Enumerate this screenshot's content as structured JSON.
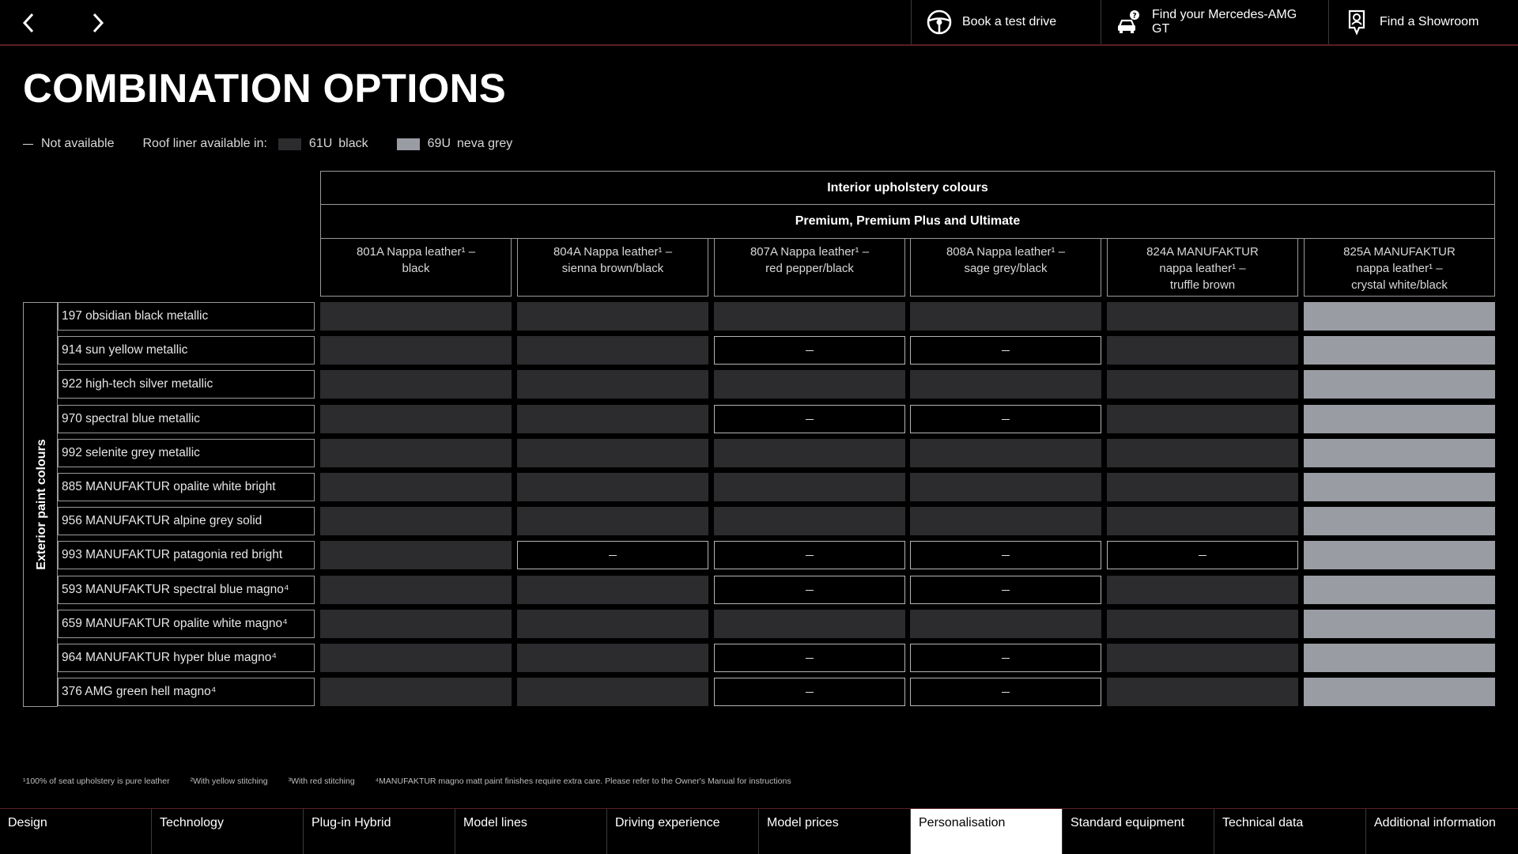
{
  "top_bar": {
    "actions": [
      {
        "label": "Book a test drive",
        "icon": "steering-wheel-icon"
      },
      {
        "label": "Find your Mercedes-AMG GT",
        "icon": "car-question-icon"
      },
      {
        "label": "Find a Showroom",
        "icon": "location-pin-icon"
      }
    ]
  },
  "page": {
    "title": "COMBINATION OPTIONS"
  },
  "legend": {
    "not_available": "Not available",
    "roof_liner_label": "Roof liner available in:",
    "roof_options": [
      {
        "code": "61U",
        "name": "black",
        "color": "#2c2c2e"
      },
      {
        "code": "69U",
        "name": "neva grey",
        "color": "#9a9ca3"
      }
    ]
  },
  "table": {
    "header_1": "Interior upholstery colours",
    "header_2": "Premium, Premium Plus and Ultimate",
    "side_label": "Exterior paint colours",
    "columns": [
      {
        "line1": "801A  Nappa leather¹ –",
        "line2": "black",
        "line3": ""
      },
      {
        "line1": "804A  Nappa leather¹ –",
        "line2": "sienna brown/black",
        "line3": ""
      },
      {
        "line1": "807A  Nappa leather¹ –",
        "line2": "red pepper/black",
        "line3": ""
      },
      {
        "line1": "808A  Nappa leather¹ –",
        "line2": "sage grey/black",
        "line3": ""
      },
      {
        "line1": "824A  MANUFAKTUR",
        "line2": "nappa leather¹ –",
        "line3": "truffle brown"
      },
      {
        "line1": "825A  MANUFAKTUR",
        "line2": "nappa leather¹ –",
        "line3": "crystal white/black"
      }
    ],
    "rows": [
      {
        "label": "197  obsidian black metallic",
        "cells": [
          "61U",
          "61U",
          "61U",
          "61U",
          "61U",
          "69U"
        ]
      },
      {
        "label": "914  sun yellow metallic",
        "cells": [
          "61U",
          "61U",
          "–",
          "–",
          "61U",
          "69U"
        ]
      },
      {
        "label": "922  high-tech silver metallic",
        "cells": [
          "61U",
          "61U",
          "61U",
          "61U",
          "61U",
          "69U"
        ]
      },
      {
        "label": "970  spectral blue metallic",
        "cells": [
          "61U",
          "61U",
          "–",
          "–",
          "61U",
          "69U"
        ]
      },
      {
        "label": "992  selenite grey metallic",
        "cells": [
          "61U",
          "61U",
          "61U",
          "61U",
          "61U",
          "69U"
        ]
      },
      {
        "label": "885  MANUFAKTUR opalite white bright",
        "cells": [
          "61U",
          "61U",
          "61U",
          "61U",
          "61U",
          "69U"
        ]
      },
      {
        "label": "956  MANUFAKTUR alpine grey solid",
        "cells": [
          "61U",
          "61U",
          "61U",
          "61U",
          "61U",
          "69U"
        ]
      },
      {
        "label": "993  MANUFAKTUR patagonia red bright",
        "cells": [
          "61U",
          "–",
          "–",
          "–",
          "–",
          "69U"
        ]
      },
      {
        "label": "593  MANUFAKTUR spectral blue magno⁴",
        "cells": [
          "61U",
          "61U",
          "–",
          "–",
          "61U",
          "69U"
        ]
      },
      {
        "label": "659  MANUFAKTUR opalite white magno⁴",
        "cells": [
          "61U",
          "61U",
          "61U",
          "61U",
          "61U",
          "69U"
        ]
      },
      {
        "label": "964  MANUFAKTUR hyper blue magno⁴",
        "cells": [
          "61U",
          "61U",
          "–",
          "–",
          "61U",
          "69U"
        ]
      },
      {
        "label": "376  AMG green hell magno⁴",
        "cells": [
          "61U",
          "61U",
          "–",
          "–",
          "61U",
          "69U"
        ]
      }
    ]
  },
  "footnotes": [
    "¹100% of seat upholstery is pure leather",
    "²With yellow stitching",
    "³With red stitching",
    "⁴MANUFAKTUR magno matt paint finishes require extra care. Please refer to the Owner's Manual for instructions"
  ],
  "bottom_nav": {
    "tabs": [
      "Design",
      "Technology",
      "Plug-in Hybrid",
      "Model lines",
      "Driving experience",
      "Model prices",
      "Personalisation",
      "Standard equipment",
      "Technical data",
      "Additional information"
    ],
    "active": "Personalisation"
  }
}
